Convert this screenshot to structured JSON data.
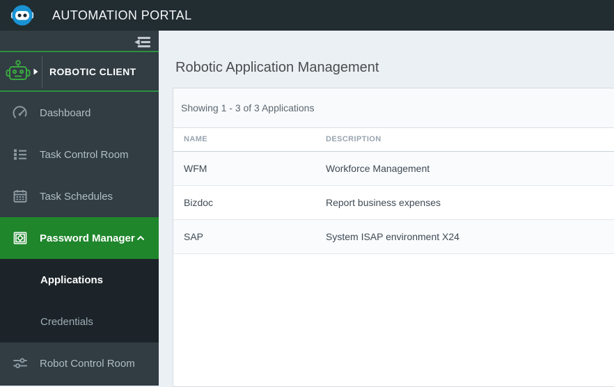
{
  "header": {
    "title": "AUTOMATION PORTAL",
    "logo_icon": "robot-logo-icon"
  },
  "sidebar": {
    "collapse_icon": "collapse-sidebar-icon",
    "client": {
      "label": "ROBOTIC CLIENT",
      "icon": "robot-client-icon",
      "caret_icon": "caret-right-icon"
    },
    "items": [
      {
        "label": "Dashboard",
        "icon": "gauge-icon",
        "active": false
      },
      {
        "label": "Task Control Room",
        "icon": "list-icon",
        "active": false
      },
      {
        "label": "Task Schedules",
        "icon": "calendar-icon",
        "active": false
      },
      {
        "label": "Password Manager",
        "icon": "safe-icon",
        "active": true,
        "expanded": true,
        "chevron_icon": "chevron-up-icon",
        "children": [
          {
            "label": "Applications",
            "active": true
          },
          {
            "label": "Credentials",
            "active": false
          }
        ]
      },
      {
        "label": "Robot Control Room",
        "icon": "sliders-icon",
        "active": false
      }
    ]
  },
  "main": {
    "page_title": "Robotic Application Management",
    "results_summary": "Showing 1 - 3 of 3 Applications",
    "table": {
      "columns": [
        "NAME",
        "DESCRIPTION"
      ],
      "rows": [
        {
          "name": "WFM",
          "description": "Workforce Management"
        },
        {
          "name": "Bizdoc",
          "description": "Report business expenses"
        },
        {
          "name": "SAP",
          "description": "System ISAP environment X24"
        }
      ]
    }
  },
  "colors": {
    "accent_green": "#1f862b",
    "divider_green": "#2a9140",
    "header_bg": "#222d32",
    "sidebar_bg": "#313c43",
    "submenu_bg": "#1c2429",
    "logo_blue": "#1a93d4",
    "content_bg": "#ebf0f5"
  }
}
